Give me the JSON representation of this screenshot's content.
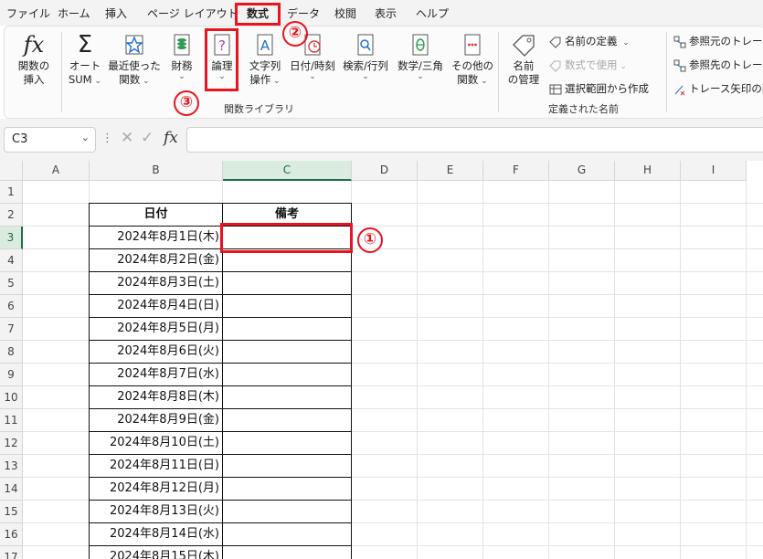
{
  "menu": [
    "ファイル",
    "ホーム",
    "挿入",
    "ページ レイアウト",
    "数式",
    "データ",
    "校閲",
    "表示",
    "ヘルプ"
  ],
  "ribbon": {
    "insert_function": [
      "関数の",
      "挿入"
    ],
    "autosum": [
      "オート",
      "SUM"
    ],
    "recent": [
      "最近使った",
      "関数"
    ],
    "financial": [
      "財務"
    ],
    "logical": [
      "論理"
    ],
    "text": [
      "文字列",
      "操作"
    ],
    "datetime": [
      "日付/時刻"
    ],
    "lookup": [
      "検索/行列"
    ],
    "math": [
      "数学/三角"
    ],
    "more": [
      "その他の",
      "関数"
    ],
    "library_label": "関数ライブラリ",
    "name_manager": [
      "名前",
      "の管理"
    ],
    "define_name": "名前の定義",
    "use_in_formula": "数式で使用",
    "create_from_selection": "選択範囲から作成",
    "defined_names_label": "定義された名前",
    "trace_precedents": "参照元のトレース",
    "trace_dependents": "参照先のトレース",
    "remove_arrows": "トレース矢印の削除",
    "fx_symbol": "fx"
  },
  "formula_bar": {
    "name_box": "C3",
    "value": ""
  },
  "columns": [
    "A",
    "B",
    "C",
    "D",
    "E",
    "F",
    "G",
    "H",
    "I"
  ],
  "rows": [
    "1",
    "2",
    "3",
    "4",
    "5",
    "6",
    "7",
    "8",
    "9",
    "10",
    "11",
    "12",
    "13",
    "14",
    "15",
    "16",
    "17"
  ],
  "table": {
    "headers": [
      "日付",
      "備考"
    ],
    "dates": [
      "2024年8月1日(木)",
      "2024年8月2日(金)",
      "2024年8月3日(土)",
      "2024年8月4日(日)",
      "2024年8月5日(月)",
      "2024年8月6日(火)",
      "2024年8月7日(水)",
      "2024年8月8日(木)",
      "2024年8月9日(金)",
      "2024年8月10日(土)",
      "2024年8月11日(日)",
      "2024年8月12日(月)",
      "2024年8月13日(火)",
      "2024年8月14日(水)",
      "2024年8月15日(木)"
    ]
  },
  "annotations": [
    "①",
    "②",
    "③"
  ],
  "colors": {
    "annotation_red": "#e8141e",
    "selection_green": "#1e7145"
  }
}
